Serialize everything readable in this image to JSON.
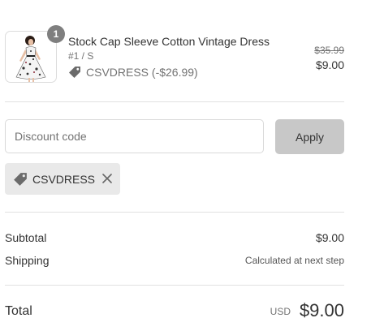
{
  "product": {
    "quantity": "1",
    "title": "Stock Cap Sleeve Cotton Vintage Dress",
    "variant": "#1 / S",
    "discount_label": "CSVDRESS (-$26.99)",
    "compare_price": "$35.99",
    "price": "$9.00",
    "image_icon": "dress-photo"
  },
  "discount": {
    "placeholder": "Discount code",
    "apply_label": "Apply",
    "applied_code": "CSVDRESS"
  },
  "summary": {
    "subtotal_label": "Subtotal",
    "subtotal_value": "$9.00",
    "shipping_label": "Shipping",
    "shipping_value": "Calculated at next step",
    "total_label": "Total",
    "currency": "USD",
    "total_value": "$9.00"
  },
  "colors": {
    "apply_button_bg": "#c8c8c8",
    "chip_bg": "#e9e9e9",
    "badge_bg": "#7f7f7f"
  }
}
